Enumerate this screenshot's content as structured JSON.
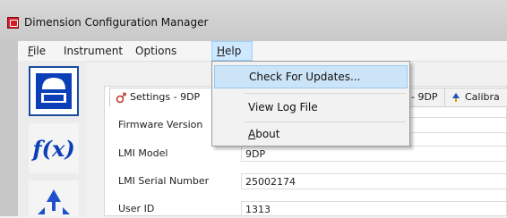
{
  "window": {
    "title": "Dimension Configuration Manager"
  },
  "menubar": {
    "items": [
      {
        "label": "File",
        "hotkey": "F"
      },
      {
        "label": "Instrument"
      },
      {
        "label": "Options"
      },
      {
        "label": "Help",
        "hotkey": "H",
        "open": true
      }
    ]
  },
  "help_menu": {
    "items": [
      {
        "label": "Check For Updates...",
        "highlighted": true
      },
      {
        "label": "View Log File"
      },
      {
        "label": "About",
        "hotkey": "A"
      }
    ]
  },
  "toolstrip": {
    "buttons": [
      {
        "icon": "device-icon",
        "active": true
      },
      {
        "icon": "function-icon",
        "glyph": "f(x)"
      },
      {
        "icon": "calibrate-icon"
      }
    ]
  },
  "tabs": [
    {
      "label": "Settings - 9DP",
      "icon": "settings-icon",
      "selected": true
    },
    {
      "label": "- 9DP",
      "icon": ""
    },
    {
      "label": "Calibra",
      "icon": "calibration-icon"
    }
  ],
  "form": {
    "fields": [
      {
        "label": "Firmware Version",
        "value": ""
      },
      {
        "label": "LMI Model",
        "value": "9DP"
      },
      {
        "label": "LMI Serial Number",
        "value": "25002174"
      },
      {
        "label": "User ID",
        "value": "1313"
      }
    ]
  },
  "colors": {
    "accent": "#1b4ba0",
    "menu_highlight": "#cce4f7",
    "app_icon": "#d21e2a"
  }
}
